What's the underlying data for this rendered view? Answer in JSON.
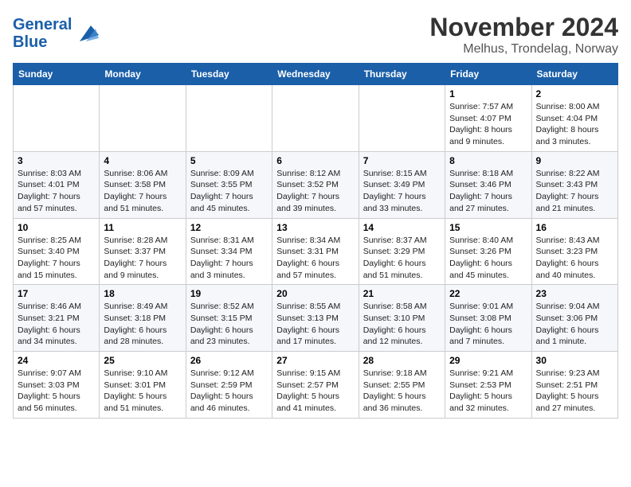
{
  "logo": {
    "line1": "General",
    "line2": "Blue"
  },
  "title": "November 2024",
  "location": "Melhus, Trondelag, Norway",
  "days_of_week": [
    "Sunday",
    "Monday",
    "Tuesday",
    "Wednesday",
    "Thursday",
    "Friday",
    "Saturday"
  ],
  "weeks": [
    [
      {
        "day": "",
        "info": ""
      },
      {
        "day": "",
        "info": ""
      },
      {
        "day": "",
        "info": ""
      },
      {
        "day": "",
        "info": ""
      },
      {
        "day": "",
        "info": ""
      },
      {
        "day": "1",
        "info": "Sunrise: 7:57 AM\nSunset: 4:07 PM\nDaylight: 8 hours and 9 minutes."
      },
      {
        "day": "2",
        "info": "Sunrise: 8:00 AM\nSunset: 4:04 PM\nDaylight: 8 hours and 3 minutes."
      }
    ],
    [
      {
        "day": "3",
        "info": "Sunrise: 8:03 AM\nSunset: 4:01 PM\nDaylight: 7 hours and 57 minutes."
      },
      {
        "day": "4",
        "info": "Sunrise: 8:06 AM\nSunset: 3:58 PM\nDaylight: 7 hours and 51 minutes."
      },
      {
        "day": "5",
        "info": "Sunrise: 8:09 AM\nSunset: 3:55 PM\nDaylight: 7 hours and 45 minutes."
      },
      {
        "day": "6",
        "info": "Sunrise: 8:12 AM\nSunset: 3:52 PM\nDaylight: 7 hours and 39 minutes."
      },
      {
        "day": "7",
        "info": "Sunrise: 8:15 AM\nSunset: 3:49 PM\nDaylight: 7 hours and 33 minutes."
      },
      {
        "day": "8",
        "info": "Sunrise: 8:18 AM\nSunset: 3:46 PM\nDaylight: 7 hours and 27 minutes."
      },
      {
        "day": "9",
        "info": "Sunrise: 8:22 AM\nSunset: 3:43 PM\nDaylight: 7 hours and 21 minutes."
      }
    ],
    [
      {
        "day": "10",
        "info": "Sunrise: 8:25 AM\nSunset: 3:40 PM\nDaylight: 7 hours and 15 minutes."
      },
      {
        "day": "11",
        "info": "Sunrise: 8:28 AM\nSunset: 3:37 PM\nDaylight: 7 hours and 9 minutes."
      },
      {
        "day": "12",
        "info": "Sunrise: 8:31 AM\nSunset: 3:34 PM\nDaylight: 7 hours and 3 minutes."
      },
      {
        "day": "13",
        "info": "Sunrise: 8:34 AM\nSunset: 3:31 PM\nDaylight: 6 hours and 57 minutes."
      },
      {
        "day": "14",
        "info": "Sunrise: 8:37 AM\nSunset: 3:29 PM\nDaylight: 6 hours and 51 minutes."
      },
      {
        "day": "15",
        "info": "Sunrise: 8:40 AM\nSunset: 3:26 PM\nDaylight: 6 hours and 45 minutes."
      },
      {
        "day": "16",
        "info": "Sunrise: 8:43 AM\nSunset: 3:23 PM\nDaylight: 6 hours and 40 minutes."
      }
    ],
    [
      {
        "day": "17",
        "info": "Sunrise: 8:46 AM\nSunset: 3:21 PM\nDaylight: 6 hours and 34 minutes."
      },
      {
        "day": "18",
        "info": "Sunrise: 8:49 AM\nSunset: 3:18 PM\nDaylight: 6 hours and 28 minutes."
      },
      {
        "day": "19",
        "info": "Sunrise: 8:52 AM\nSunset: 3:15 PM\nDaylight: 6 hours and 23 minutes."
      },
      {
        "day": "20",
        "info": "Sunrise: 8:55 AM\nSunset: 3:13 PM\nDaylight: 6 hours and 17 minutes."
      },
      {
        "day": "21",
        "info": "Sunrise: 8:58 AM\nSunset: 3:10 PM\nDaylight: 6 hours and 12 minutes."
      },
      {
        "day": "22",
        "info": "Sunrise: 9:01 AM\nSunset: 3:08 PM\nDaylight: 6 hours and 7 minutes."
      },
      {
        "day": "23",
        "info": "Sunrise: 9:04 AM\nSunset: 3:06 PM\nDaylight: 6 hours and 1 minute."
      }
    ],
    [
      {
        "day": "24",
        "info": "Sunrise: 9:07 AM\nSunset: 3:03 PM\nDaylight: 5 hours and 56 minutes."
      },
      {
        "day": "25",
        "info": "Sunrise: 9:10 AM\nSunset: 3:01 PM\nDaylight: 5 hours and 51 minutes."
      },
      {
        "day": "26",
        "info": "Sunrise: 9:12 AM\nSunset: 2:59 PM\nDaylight: 5 hours and 46 minutes."
      },
      {
        "day": "27",
        "info": "Sunrise: 9:15 AM\nSunset: 2:57 PM\nDaylight: 5 hours and 41 minutes."
      },
      {
        "day": "28",
        "info": "Sunrise: 9:18 AM\nSunset: 2:55 PM\nDaylight: 5 hours and 36 minutes."
      },
      {
        "day": "29",
        "info": "Sunrise: 9:21 AM\nSunset: 2:53 PM\nDaylight: 5 hours and 32 minutes."
      },
      {
        "day": "30",
        "info": "Sunrise: 9:23 AM\nSunset: 2:51 PM\nDaylight: 5 hours and 27 minutes."
      }
    ]
  ]
}
